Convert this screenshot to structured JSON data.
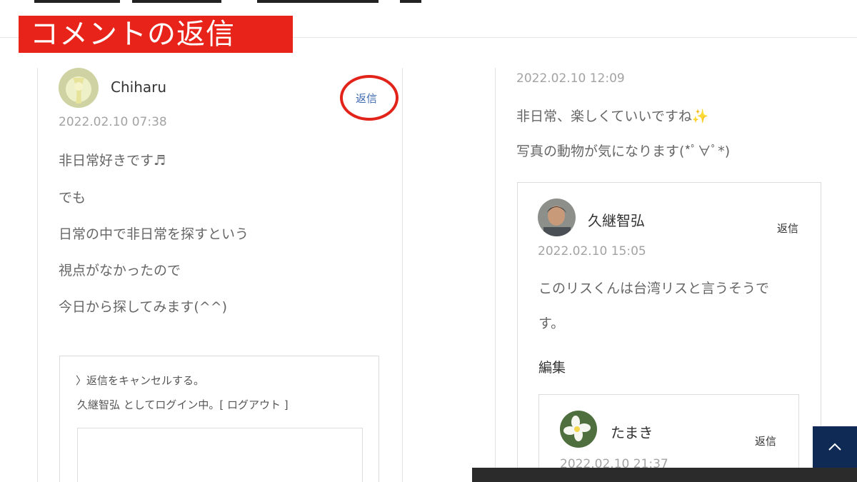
{
  "banner": {
    "title": "コメントの返信"
  },
  "left_comment": {
    "author": "Chiharu",
    "date": "2022.02.10 07:38",
    "reply_label": "返信",
    "lines": [
      "非日常好きです♬",
      "でも",
      "日常の中で非日常を探すという",
      "視点がなかったので",
      "今日から探してみます(^^)"
    ]
  },
  "reply_form": {
    "cancel_label": "〉返信をキャンセルする。",
    "login_text": "久継智弘 としてログイン中。[ ログアウト ]",
    "textarea_value": ""
  },
  "right_comment": {
    "date": "2022.02.10 12:09",
    "lines": [
      "非日常、楽しくていいですね✨",
      "写真の動物が気になります(*ﾟ∀ﾟ*)"
    ]
  },
  "nested_comment": {
    "author": "久継智弘",
    "reply_label": "返信",
    "date": "2022.02.10 15:05",
    "lines": [
      "このリスくんは台湾リスと言うそうで",
      "す。"
    ],
    "edit_label": "編集"
  },
  "nested_comment_2": {
    "author": "たまき",
    "reply_label": "返信",
    "date": "2022.02.10 21:37"
  },
  "icons": {
    "back_to_top": "chevron-up-icon"
  },
  "colors": {
    "banner": "#e8231a",
    "highlight_circle": "#e2231a",
    "back_to_top": "#0f2a55",
    "reply_link": "#3d6ab0"
  }
}
